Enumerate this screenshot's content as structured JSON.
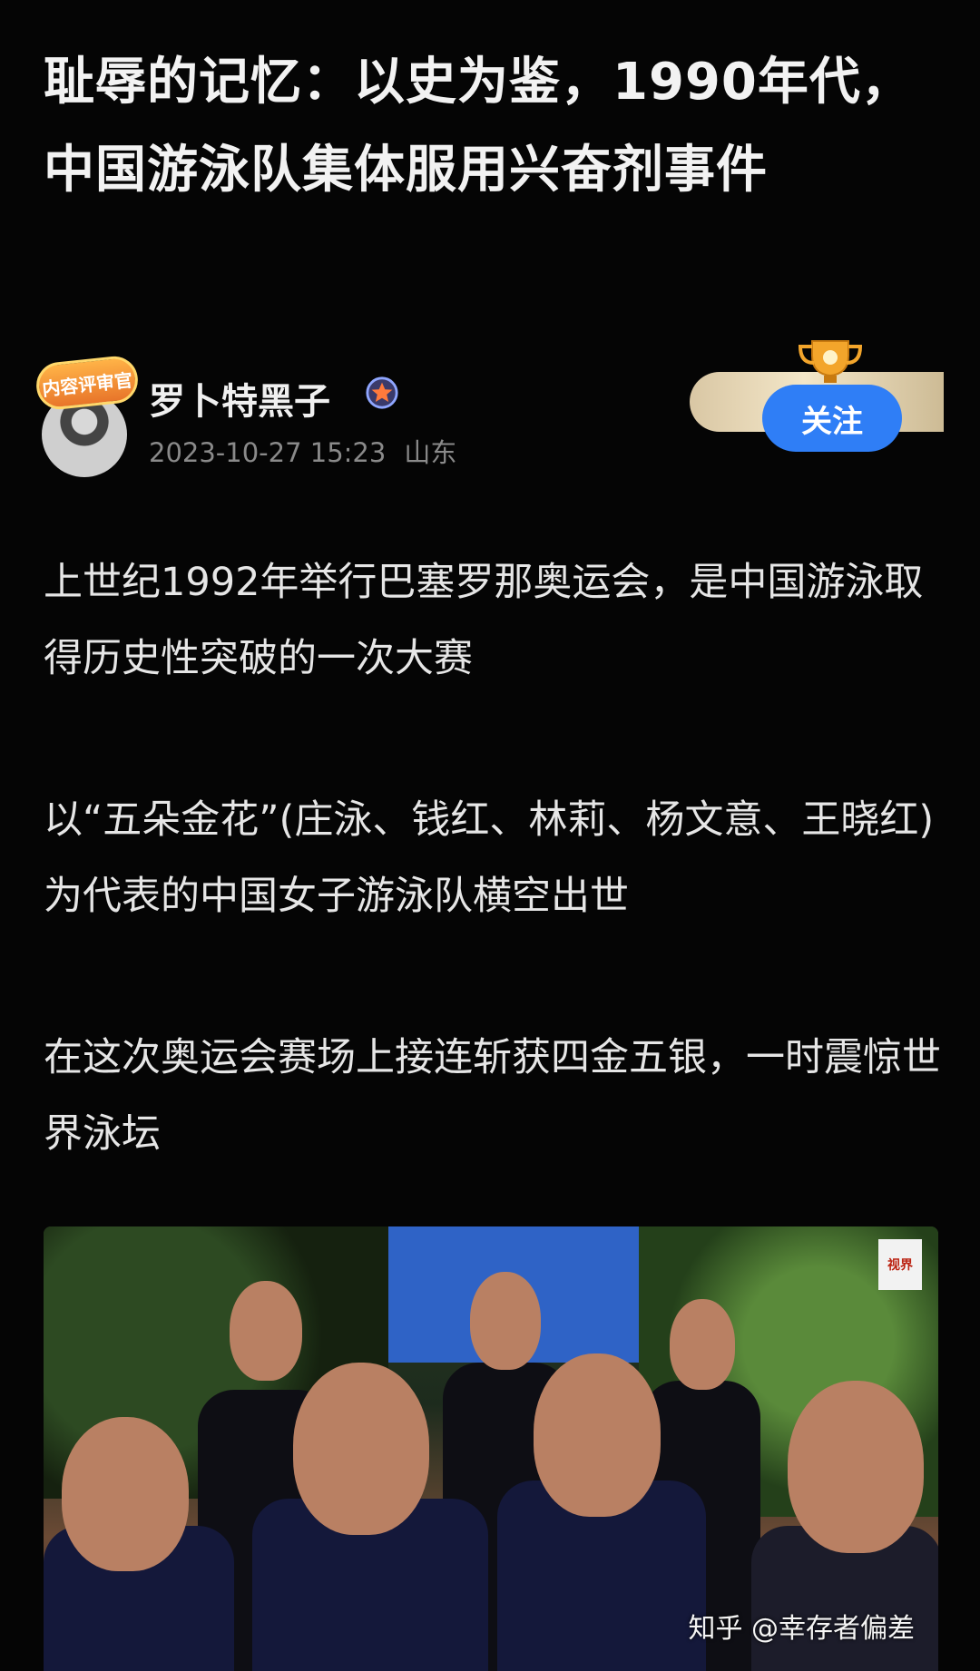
{
  "article": {
    "title": "耻辱的记忆：以史为鉴，1990年代，中国游泳队集体服用兴奋剂事件"
  },
  "author": {
    "badge": "内容评审官",
    "name": "罗卜特黑子",
    "date": "2023-10-27 15:23",
    "location": "山东",
    "follow_label": "关注"
  },
  "paragraphs": [
    "上世纪1992年举行巴塞罗那奥运会，是中国游泳取得历史性突破的一次大赛",
    "以“五朵金花”(庄泳、钱红、林莉、杨文意、王晓红)为代表的中国女子游泳队横空出世",
    "在这次奥运会赛场上接连斩获四金五银，一时震惊世界泳坛"
  ],
  "photo": {
    "corner_logo": "视界",
    "watermark": "知乎 @幸存者偏差"
  },
  "colors": {
    "background": "#050505",
    "follow_button": "#2f7ef6"
  }
}
